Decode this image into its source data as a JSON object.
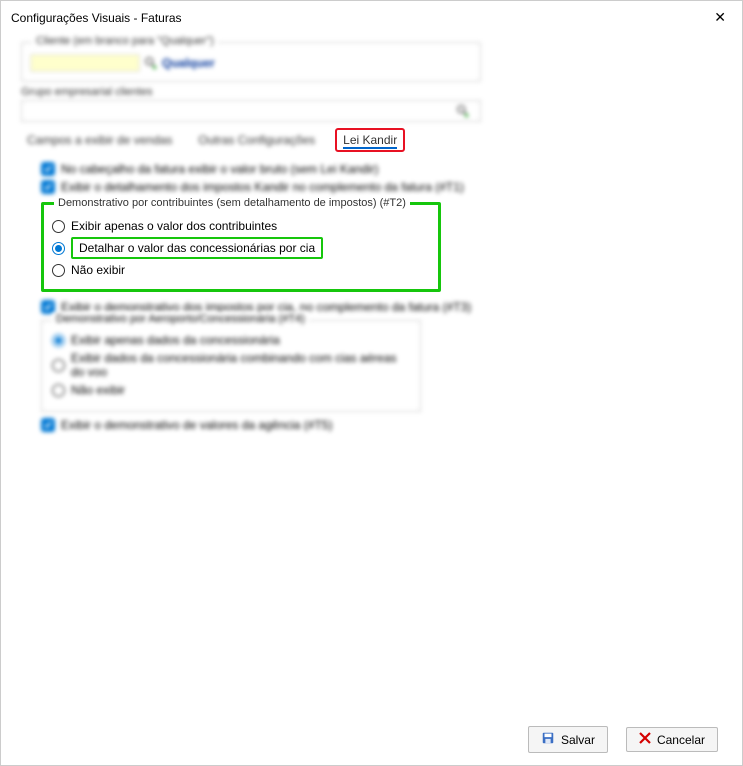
{
  "window": {
    "title": "Configurações Visuais - Faturas",
    "close": "✕"
  },
  "client": {
    "group_label": "Cliente (em branco para \"Qualquer\")",
    "icon": "search",
    "qualquer": "Qualquer"
  },
  "grupo": {
    "label": "Grupo empresarial clientes",
    "icon": "search"
  },
  "tabs": {
    "campos": "Campos a exibir de vendas",
    "outras": "Outras Configurações",
    "kandir": "Lei Kandir"
  },
  "opts": {
    "cabecalho": "No cabeçalho da fatura exibir o valor bruto (sem Lei Kandir)",
    "detalhamento": "Exibir o detalhamento dos impostos Kandir no complemento da fatura (#T1)"
  },
  "t2": {
    "legend": "Demonstrativo por contribuintes (sem detalhamento de impostos) (#T2)",
    "r1": "Exibir apenas o valor dos contribuintes",
    "r2": "Detalhar o valor das concessionárias por cia",
    "r3": "Não exibir"
  },
  "t3": "Exibir o demonstrativo dos impostos por cia, no complemento da fatura (#T3)",
  "t4": {
    "legend": "Demonstrativo por Aeroporto/Concessionária (#T4)",
    "r1": "Exibir apenas dados da concessionária",
    "r2": "Exibir dados da concessionária combinando com cias aéreas do voo",
    "r3": "Não exibir"
  },
  "t5": "Exibir o demonstrativo de valores da agência (#T5)",
  "footer": {
    "save": "Salvar",
    "cancel": "Cancelar"
  }
}
